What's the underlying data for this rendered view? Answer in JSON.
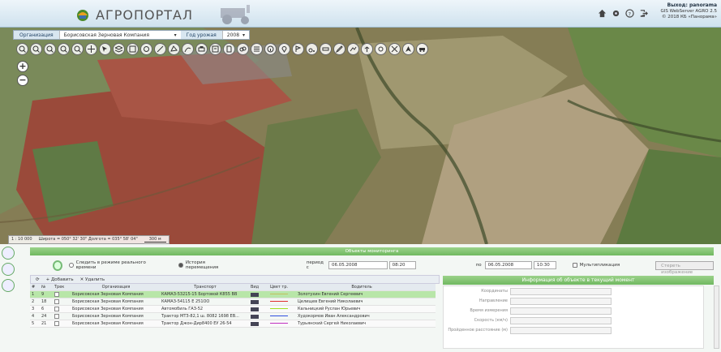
{
  "header": {
    "app_title": "АГРОПОРТАЛ",
    "user_line1": "Выход: panorama",
    "user_line2": "GIS WebServer AGRO 2.5",
    "user_line3": "© 2018 КБ «Панорама»",
    "icons": [
      "home-icon",
      "settings-icon",
      "help-icon",
      "logout-icon"
    ]
  },
  "filter": {
    "org_label": "Организация",
    "org_value": "Борисовская Зерновая Компания",
    "year_label": "Год урожая",
    "year_value": "2008"
  },
  "map": {
    "zoom_in": "+",
    "zoom_out": "−",
    "scale": "1 : 10 000",
    "coords": "Широта = 050° 32' 30\" Долгота = 035° 58' 04\"",
    "scale_bar": "300 м"
  },
  "panel": {
    "title": "Объекты мониторинга",
    "realtime_label": "Следить в режиме реального времени",
    "history_label": "История перемещения",
    "period_from_label": "период с",
    "date_from": "06.05.2008",
    "time_from": "08:20",
    "period_to_label": "по",
    "date_to": "06.05.2008",
    "time_to": "10:30",
    "multi_label": "Мультипликация",
    "clear_button": "Стереть изображение",
    "add_button": "Добавить",
    "delete_button": "Удалить"
  },
  "table": {
    "columns": [
      "#",
      "№",
      "Трек",
      "Организация",
      "Транспорт",
      "Вид",
      "Цвет тр.",
      "Водитель"
    ],
    "rows": [
      {
        "idx": "1",
        "num": "9",
        "org": "Борисовская Зерновая Компания",
        "transport": "КАМАЗ-53215-15 Бортовой К855 ВВ",
        "color": "#c0c060",
        "driver": "Золотухин Евгений Сергеевич"
      },
      {
        "idx": "2",
        "num": "18",
        "org": "Борисовская Зерновая Компания",
        "transport": "КАМАЗ-54115 Е 251ОО",
        "color": "#e03030",
        "driver": "Целищев Евгений Николаевич"
      },
      {
        "idx": "3",
        "num": "6",
        "org": "Борисовская Зерновая Компания",
        "transport": "Автомобиль ГАЗ-52",
        "color": "#a0e020",
        "driver": "Кальницкий Руслан Юрьевич"
      },
      {
        "idx": "4",
        "num": "24",
        "org": "Борисовская Зерновая Компания",
        "transport": "Трактор МТЗ-82,1 ш. 8082 1698 ЕВ...",
        "color": "#3050e0",
        "driver": "Худокормов Иван Александрович"
      },
      {
        "idx": "5",
        "num": "21",
        "org": "Борисовская Зерновая Компания",
        "transport": "Трактор Джон-Дир8400 ЕУ 26-54",
        "color": "#c030c0",
        "driver": "Турьянский Сергей Николаевич"
      }
    ]
  },
  "info": {
    "title": "Информация об объекте в текущий момент",
    "fields": [
      "Координаты",
      "Направление",
      "Время измерения",
      "Скорость (км/ч)",
      "Пройденное расстояние (м)"
    ]
  }
}
